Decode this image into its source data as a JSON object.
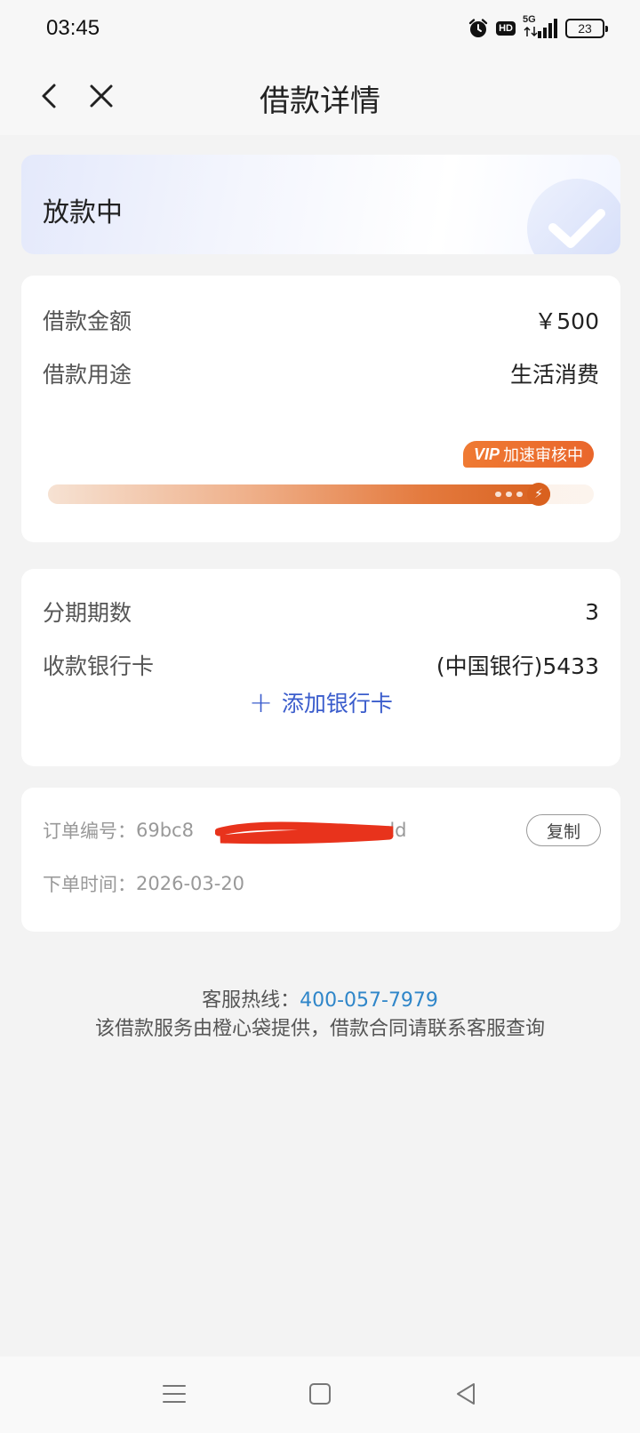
{
  "status_bar": {
    "time": "03:45",
    "hd_badge": "HD",
    "network": "5G",
    "battery": "23",
    "icons": [
      "alarm-icon",
      "hd-icon",
      "signal-icon",
      "battery-icon"
    ]
  },
  "header": {
    "title": "借款详情",
    "back_icon": "chevron-left-icon",
    "close_icon": "close-icon"
  },
  "status_card": {
    "text": "放款中",
    "icon": "check-circle-icon"
  },
  "loan_info": {
    "amount_label": "借款金额",
    "amount_value": "￥500",
    "purpose_label": "借款用途",
    "purpose_value": "生活消费",
    "vip_prefix": "VIP",
    "vip_text": "加速审核中",
    "progress_fraction": 0.92,
    "progress_icon": "lightning-icon"
  },
  "installment_info": {
    "periods_label": "分期期数",
    "periods_value": "3",
    "bank_label": "收款银行卡",
    "bank_value": "(中国银行)5433",
    "add_card_icon": "plus-icon",
    "add_card_label": "添加银行卡"
  },
  "order_info": {
    "order_no_label": "订单编号：",
    "order_no_prefix": "69bc8",
    "order_no_suffix": "add",
    "copy_label": "复制",
    "order_time_label": "下单时间：",
    "order_time_value": "2026-03-20"
  },
  "footer": {
    "hotline_label": "客服热线：",
    "hotline_number": "400-057-7979",
    "note": "该借款服务由橙心袋提供，借款合同请联系客服查询"
  },
  "system_nav": {
    "icons": [
      "menu-icon",
      "home-square-icon",
      "back-triangle-icon"
    ]
  },
  "colors": {
    "accent_orange": "#e4692b",
    "link_blue": "#3a5ccc",
    "hotline_blue": "#2f86c9",
    "redaction_red": "#e8331c"
  }
}
